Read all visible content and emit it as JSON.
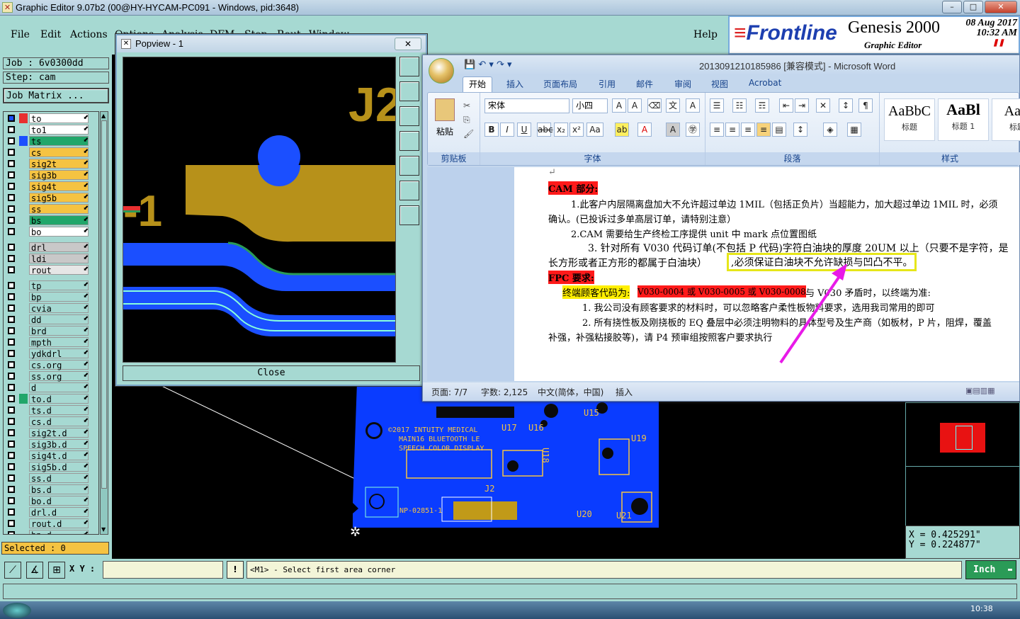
{
  "app": {
    "title": "Graphic Editor 9.07b2 (00@HY-HYCAM-PC091 - Windows, pid:3648)",
    "window_buttons": [
      "–",
      "□",
      "✕"
    ]
  },
  "menu": {
    "items": [
      "File",
      "Edit",
      "Actions",
      "Options",
      "Analysis",
      "DFM",
      "Step",
      "Rout",
      "Window"
    ],
    "help": "Help"
  },
  "brand": {
    "logo": "Frontline",
    "product": "Genesis 2000",
    "subtitle": "Graphic Editor",
    "date": "08 Aug 2017",
    "time": "10:32 AM"
  },
  "left": {
    "job": "Job : 6v0300dd",
    "step": "Step: cam",
    "job_matrix": "Job Matrix ...",
    "layers": [
      {
        "name": "to",
        "color": "#ffffff",
        "swatch": "#e83030",
        "active": true
      },
      {
        "name": "to1",
        "color": "#ffffff",
        "swatch": "#a6d9d2"
      },
      {
        "name": "ts",
        "color": "#21a66a",
        "swatch": "#1b4fff"
      },
      {
        "name": "cs",
        "color": "#f5c342",
        "swatch": "#a6d9d2"
      },
      {
        "name": "sig2t",
        "color": "#f5c342",
        "swatch": "#a6d9d2"
      },
      {
        "name": "sig3b",
        "color": "#f5c342",
        "swatch": "#a6d9d2"
      },
      {
        "name": "sig4t",
        "color": "#f5c342",
        "swatch": "#a6d9d2"
      },
      {
        "name": "sig5b",
        "color": "#f5c342",
        "swatch": "#a6d9d2"
      },
      {
        "name": "ss",
        "color": "#f5c342",
        "swatch": "#a6d9d2"
      },
      {
        "name": "bs",
        "color": "#21a66a",
        "swatch": "#a6d9d2"
      },
      {
        "name": "bo",
        "color": "#ffffff",
        "swatch": "#a6d9d2"
      },
      {
        "name": "drl",
        "color": "#c8c8c8",
        "swatch": "#a6d9d2"
      },
      {
        "name": "ldi",
        "color": "#c8c8c8",
        "swatch": "#a6d9d2"
      },
      {
        "name": "rout",
        "color": "#e6e6e6",
        "swatch": "#a6d9d2"
      },
      {
        "name": "tp",
        "color": "#a6d9d2",
        "swatch": "#a6d9d2"
      },
      {
        "name": "bp",
        "color": "#a6d9d2",
        "swatch": "#a6d9d2"
      },
      {
        "name": "cvia",
        "color": "#a6d9d2",
        "swatch": "#a6d9d2"
      },
      {
        "name": "dd",
        "color": "#a6d9d2",
        "swatch": "#a6d9d2"
      },
      {
        "name": "brd",
        "color": "#a6d9d2",
        "swatch": "#a6d9d2"
      },
      {
        "name": "mpth",
        "color": "#a6d9d2",
        "swatch": "#a6d9d2"
      },
      {
        "name": "ydkdrl",
        "color": "#a6d9d2",
        "swatch": "#a6d9d2"
      },
      {
        "name": "cs.org",
        "color": "#a6d9d2",
        "swatch": "#a6d9d2"
      },
      {
        "name": "ss.org",
        "color": "#a6d9d2",
        "swatch": "#a6d9d2"
      },
      {
        "name": "d",
        "color": "#a6d9d2",
        "swatch": "#a6d9d2"
      },
      {
        "name": "to.d",
        "color": "#a6d9d2",
        "swatch": "#21a66a"
      },
      {
        "name": "ts.d",
        "color": "#a6d9d2",
        "swatch": "#a6d9d2"
      },
      {
        "name": "cs.d",
        "color": "#a6d9d2",
        "swatch": "#a6d9d2"
      },
      {
        "name": "sig2t.d",
        "color": "#a6d9d2",
        "swatch": "#a6d9d2"
      },
      {
        "name": "sig3b.d",
        "color": "#a6d9d2",
        "swatch": "#a6d9d2"
      },
      {
        "name": "sig4t.d",
        "color": "#a6d9d2",
        "swatch": "#a6d9d2"
      },
      {
        "name": "sig5b.d",
        "color": "#a6d9d2",
        "swatch": "#a6d9d2"
      },
      {
        "name": "ss.d",
        "color": "#a6d9d2",
        "swatch": "#a6d9d2"
      },
      {
        "name": "bs.d",
        "color": "#a6d9d2",
        "swatch": "#a6d9d2"
      },
      {
        "name": "bo.d",
        "color": "#a6d9d2",
        "swatch": "#a6d9d2"
      },
      {
        "name": "drl.d",
        "color": "#a6d9d2",
        "swatch": "#a6d9d2"
      },
      {
        "name": "rout.d",
        "color": "#a6d9d2",
        "swatch": "#a6d9d2"
      },
      {
        "name": "bp.d",
        "color": "#a6d9d2",
        "swatch": "#a6d9d2"
      }
    ],
    "selected": "Selected : 0"
  },
  "popview": {
    "title": "Popview - 1",
    "close": "Close",
    "ref_label": "J2",
    "side_label": "-1"
  },
  "board": {
    "texts": [
      "©2017 INTUITY MEDICAL",
      "MAIN16 BLUETOOTH LE",
      "SPEECH COLOR DISPLAY"
    ],
    "refs": [
      "U17",
      "U16",
      "U15",
      "U18",
      "U19",
      "J2",
      "U20",
      "U21",
      "NP-02851-1"
    ]
  },
  "coords": {
    "x": "X = 0.425291\"",
    "y": "Y = 0.224877\""
  },
  "bottom": {
    "xy_label": "X Y :",
    "xy_value": "",
    "prompt": "<M1> - Select first area corner",
    "units": "Inch"
  },
  "word": {
    "title": "2013091210185986 [兼容模式] - Microsoft Word",
    "tabs": [
      "开始",
      "插入",
      "页面布局",
      "引用",
      "邮件",
      "审阅",
      "视图",
      "Acrobat"
    ],
    "groups": {
      "clipboard": "剪贴板",
      "paste": "粘贴",
      "font": "字体",
      "paragraph": "段落",
      "styles": "样式"
    },
    "font_name": "宋体",
    "font_size": "小四",
    "styles": [
      {
        "preview": "AaBbC",
        "label": "标题"
      },
      {
        "preview": "AaBl",
        "label": "标题 1"
      },
      {
        "preview": "AaB",
        "label": "标题"
      }
    ],
    "doc": {
      "h1": "CAM 部分:",
      "p1a": "1.此客户内层隔离盘加大不允许超过单边 1MIL（包括正负片）当超能力，加大超过单边 1MIL 时，必须",
      "p1b": "确认。(已投诉过多单高层订单，请特别注意）",
      "p2": "2.CAM 需要给生产终检工序提供 unit 中 mark 点位置图纸",
      "p3a": "3. 针对所有 V030 代码订单(不包括 P 代码)字符白油块的厚度 20UM 以上（只要不是字符，是",
      "p3b": "长方形或者正方形的都属于白油块）",
      "p3c": ",必须保证白油块不允许缺损与凹凸不平。",
      "h2": "FPC 要求:",
      "c1": "终端顾客代码为:",
      "c2": "V030-0004 或 V030-0005 或 V030-0008",
      "c3": "与 V030 矛盾时，以终端为准:",
      "f1": "1. 我公司没有顾客要求的材料时，可以忽略客户柔性板物料要求，选用我司常用的即可",
      "f2a": "2. 所有挠性板及刚挠板的 EQ 叠层中必须注明物料的具体型号及生产商（如板材，P 片，阻焊，覆盖",
      "f2b": "补强，补强粘接胶等)，请 P4 预审组按照客户要求执行"
    },
    "status": {
      "page": "页面: 7/7",
      "words": "字数: 2,125",
      "lang": "中文(简体，中国)",
      "mode": "插入"
    }
  },
  "taskbar": {
    "clock": "10:38"
  }
}
